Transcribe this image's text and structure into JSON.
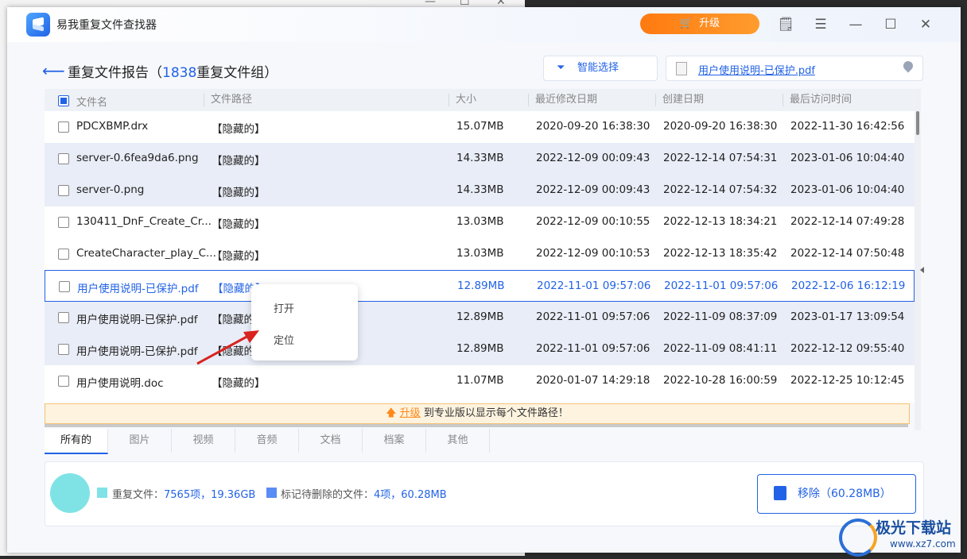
{
  "app": {
    "title": "易我重复文件查找器",
    "upgrade_label": "升级"
  },
  "header": {
    "title_prefix": "重复文件报告（",
    "group_count": "1838",
    "title_suffix": "重复文件组）",
    "smart_select_label": "智能选择",
    "selected_path": "用户使用说明-已保护.pdf"
  },
  "table": {
    "columns": [
      "文件名",
      "文件路径",
      "大小",
      "最近修改日期",
      "创建日期",
      "最后访问时间"
    ],
    "rows": [
      {
        "name": "PDCXBMP.drx",
        "path": "【隐藏的】",
        "size": "15.07MB",
        "modified": "2020-09-20 16:38:30",
        "created": "2020-09-20 16:38:30",
        "accessed": "2022-11-30 16:42:56"
      },
      {
        "name": "server-0.6fea9da6.png",
        "path": "【隐藏的】",
        "size": "14.33MB",
        "modified": "2022-12-09 00:09:43",
        "created": "2022-12-14 07:54:31",
        "accessed": "2023-01-06 10:04:40"
      },
      {
        "name": "server-0.png",
        "path": "【隐藏的】",
        "size": "14.33MB",
        "modified": "2022-12-09 00:09:43",
        "created": "2022-12-14 07:54:32",
        "accessed": "2023-01-06 10:04:40"
      },
      {
        "name": "130411_DnF_Create_Cr...",
        "path": "【隐藏的】",
        "size": "13.03MB",
        "modified": "2022-12-09 00:10:55",
        "created": "2022-12-13 18:34:21",
        "accessed": "2022-12-14 07:49:28"
      },
      {
        "name": "CreateCharacter_play_C...",
        "path": "【隐藏的】",
        "size": "13.03MB",
        "modified": "2022-12-09 00:10:53",
        "created": "2022-12-13 18:35:42",
        "accessed": "2022-12-14 07:50:48"
      },
      {
        "name": "用户使用说明-已保护.pdf",
        "path": "【隐藏的】",
        "size": "12.89MB",
        "modified": "2022-11-01 09:57:06",
        "created": "2022-11-01 09:57:06",
        "accessed": "2022-12-06 16:12:19"
      },
      {
        "name": "用户使用说明-已保护.pdf",
        "path": "【隐藏的】",
        "size": "12.89MB",
        "modified": "2022-11-01 09:57:06",
        "created": "2022-11-09 08:37:09",
        "accessed": "2023-01-17 13:09:54"
      },
      {
        "name": "用户使用说明-已保护.pdf",
        "path": "【隐藏的】",
        "size": "12.89MB",
        "modified": "2022-11-01 09:57:06",
        "created": "2022-11-09 08:41:11",
        "accessed": "2022-12-12 09:55:40"
      },
      {
        "name": "用户使用说明.doc",
        "path": "【隐藏的】",
        "size": "11.07MB",
        "modified": "2020-01-07 14:29:18",
        "created": "2022-10-28 16:00:59",
        "accessed": "2022-12-25 10:12:45"
      }
    ]
  },
  "context_menu": {
    "items": [
      "打开",
      "定位"
    ]
  },
  "notice": {
    "link": "升级",
    "text": " 到专业版以显示每个文件路径！"
  },
  "tabs": [
    "所有的",
    "图片",
    "视频",
    "音频",
    "文档",
    "档案",
    "其他"
  ],
  "summary": {
    "dup_label": "重复文件：",
    "dup_value": "7565项，19.36GB",
    "marked_label": "标记待删除的文件：",
    "marked_value": "4项，60.28MB",
    "remove_label": "移除（60.28MB）"
  },
  "watermark": {
    "brand": "极光下载站",
    "url": "www.xz7.com"
  },
  "colors": {
    "accent": "#2262e6",
    "upgrade": "#ff8a1a",
    "pie": "#7fe3e6"
  }
}
